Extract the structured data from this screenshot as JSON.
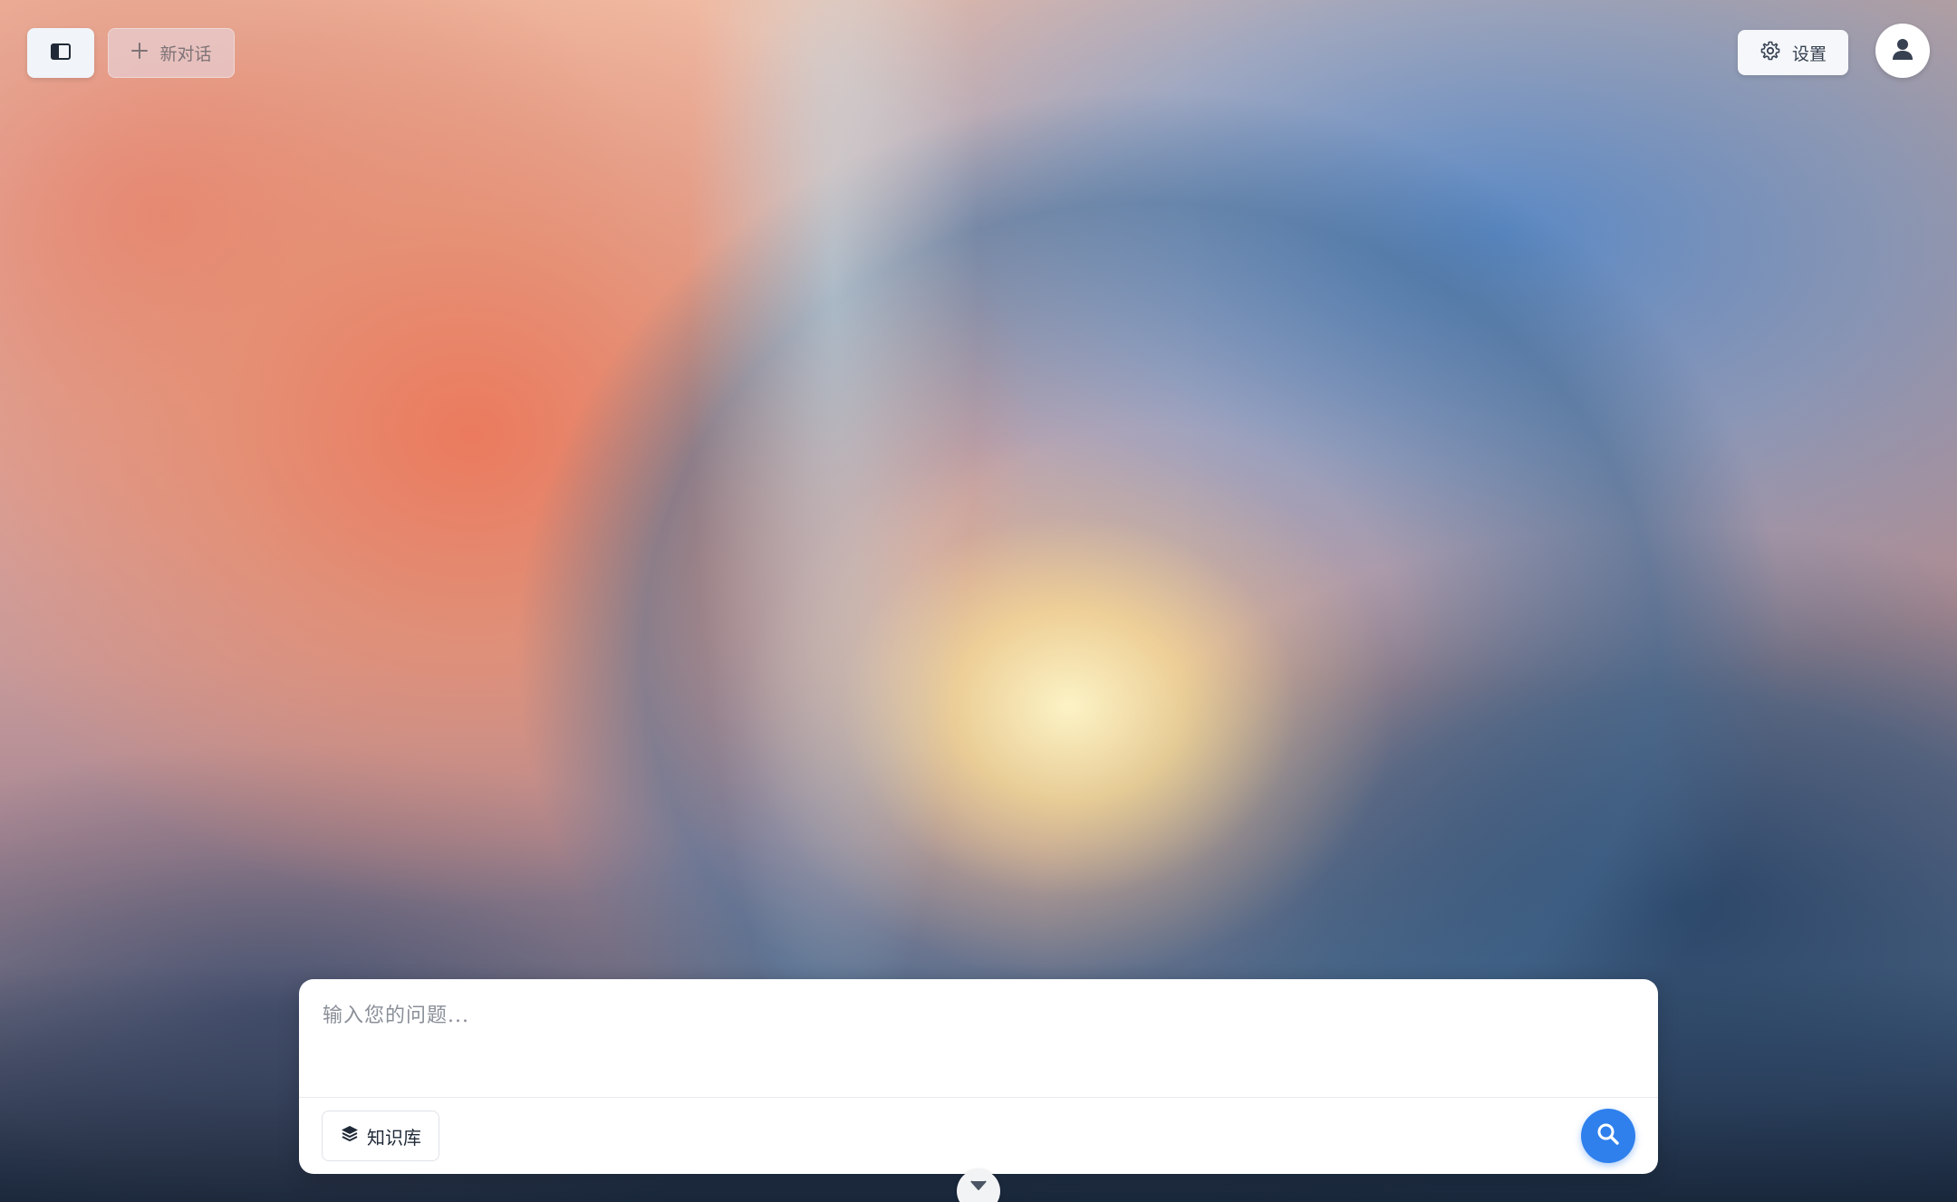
{
  "header": {
    "sidebar_toggle_icon": "sidebar-panel-icon",
    "new_chat_icon": "plus-icon",
    "new_chat_label": "新对话",
    "settings_icon": "gear-icon",
    "settings_label": "设置",
    "avatar_icon": "user-icon"
  },
  "composer": {
    "placeholder": "输入您的问题...",
    "value": "",
    "knowledge_base_icon": "layers-icon",
    "knowledge_base_label": "知识库",
    "send_icon": "search-icon"
  },
  "scroll_toggle_icon": "chevron-down-icon",
  "colors": {
    "accent": "#2f80ed",
    "panel": "#ffffff"
  }
}
